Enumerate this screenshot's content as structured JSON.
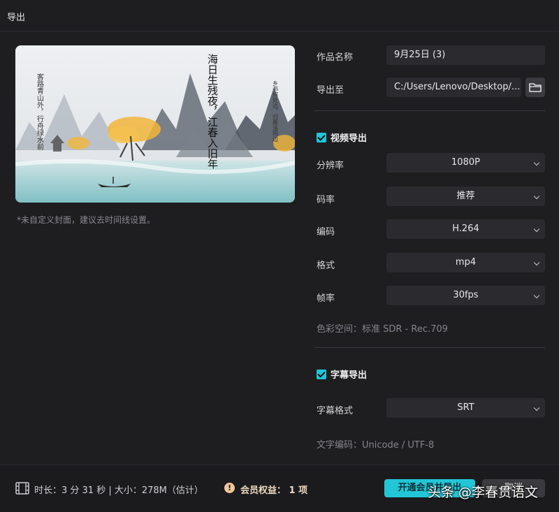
{
  "window": {
    "title": "导出"
  },
  "preview": {
    "poem_lines": [
      "海日生残夜，江春入旧年",
      "客路青山外，行舟绿水前",
      "乡书何处达，归雁洛阳边"
    ],
    "note": "*未自定义封面，建议去时间线设置。"
  },
  "form": {
    "name_label": "作品名称",
    "name_value": "9月25日 (3)",
    "export_to_label": "导出至",
    "export_to_value": "C:/Users/Lenovo/Desktop/...",
    "folder_icon": "folder-icon"
  },
  "video_export": {
    "title": "视频导出",
    "checked": true,
    "resolution_label": "分辨率",
    "resolution_value": "1080P",
    "bitrate_label": "码率",
    "bitrate_value": "推荐",
    "codec_label": "编码",
    "codec_value": "H.264",
    "format_label": "格式",
    "format_value": "mp4",
    "framerate_label": "帧率",
    "framerate_value": "30fps",
    "color_space": "色彩空间：标准 SDR - Rec.709"
  },
  "subtitle_export": {
    "title": "字幕导出",
    "checked": true,
    "format_label": "字幕格式",
    "format_value": "SRT",
    "encoding": "文字编码：Unicode / UTF-8"
  },
  "footer": {
    "meta": "时长：3 分 31 秒 | 大小：278M（估计）",
    "perk": "会员权益： 1 项",
    "vip_button": "开通会员并导出",
    "cancel_button": "取消"
  },
  "watermark": "头条 @李春贯语文",
  "colors": {
    "accent": "#22c6d6",
    "background": "#1e1e21",
    "field": "#2b2b2f"
  }
}
